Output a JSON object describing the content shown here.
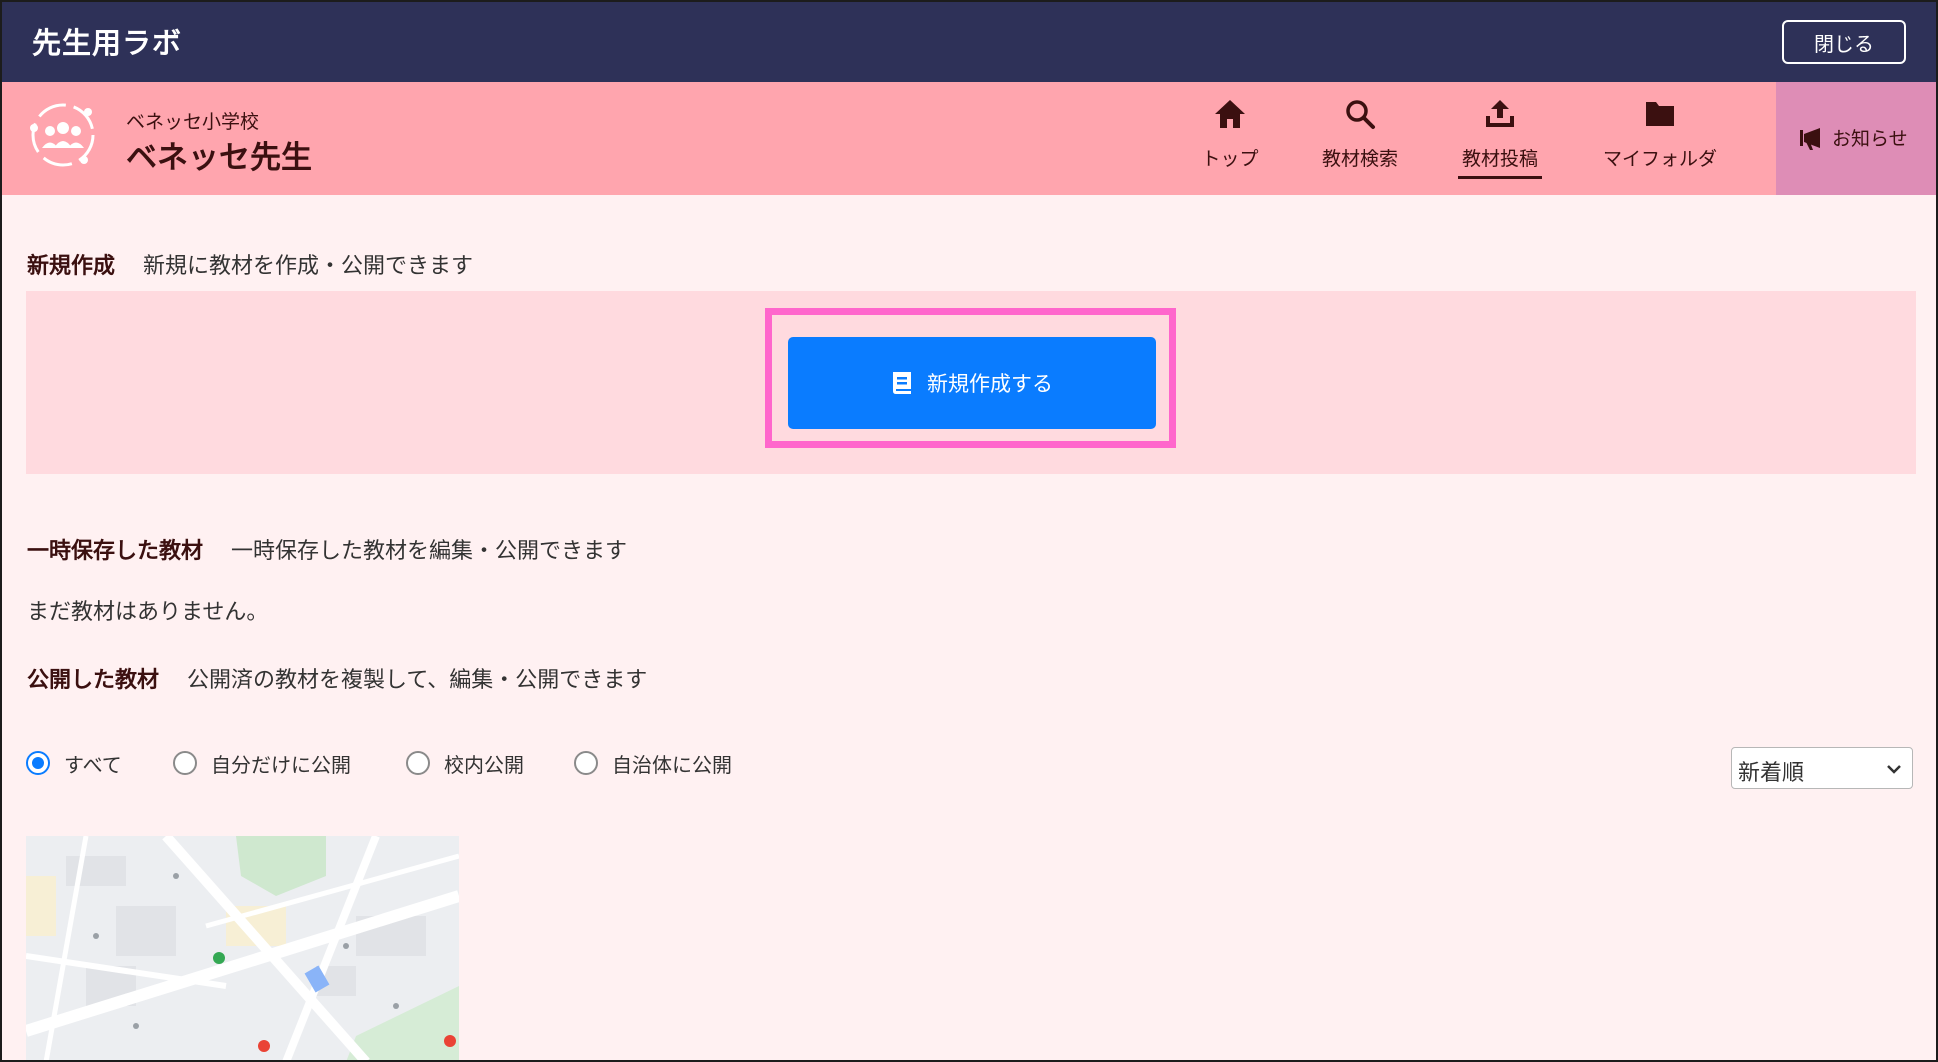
{
  "topbar": {
    "title": "先生用ラボ",
    "close_label": "閉じる"
  },
  "header": {
    "school_name": "ベネッセ小学校",
    "teacher_name": "ベネッセ先生",
    "nav": [
      {
        "label": "トップ",
        "icon": "home-icon"
      },
      {
        "label": "教材検索",
        "icon": "search-icon"
      },
      {
        "label": "教材投稿",
        "icon": "upload-icon",
        "active": true
      },
      {
        "label": "マイフォルダ",
        "icon": "folder-icon"
      }
    ],
    "notice_label": "お知らせ"
  },
  "sections": {
    "new": {
      "title": "新規作成",
      "desc": "新規に教材を作成・公開できます",
      "button_label": "新規作成する"
    },
    "drafts": {
      "title": "一時保存した教材",
      "desc": "一時保存した教材を編集・公開できます",
      "empty": "まだ教材はありません。"
    },
    "published": {
      "title": "公開した教材",
      "desc": "公開済の教材を複製して、編集・公開できます",
      "filters": [
        {
          "label": "すべて",
          "checked": true
        },
        {
          "label": "自分だけに公開",
          "checked": false
        },
        {
          "label": "校内公開",
          "checked": false
        },
        {
          "label": "自治体に公開",
          "checked": false
        }
      ],
      "sort_selected": "新着順"
    }
  },
  "colors": {
    "topbar": "#2e3158",
    "header": "#ffa5ae",
    "notice": "#de8db6",
    "primary": "#0a7cff",
    "highlight": "#ff66cc"
  }
}
